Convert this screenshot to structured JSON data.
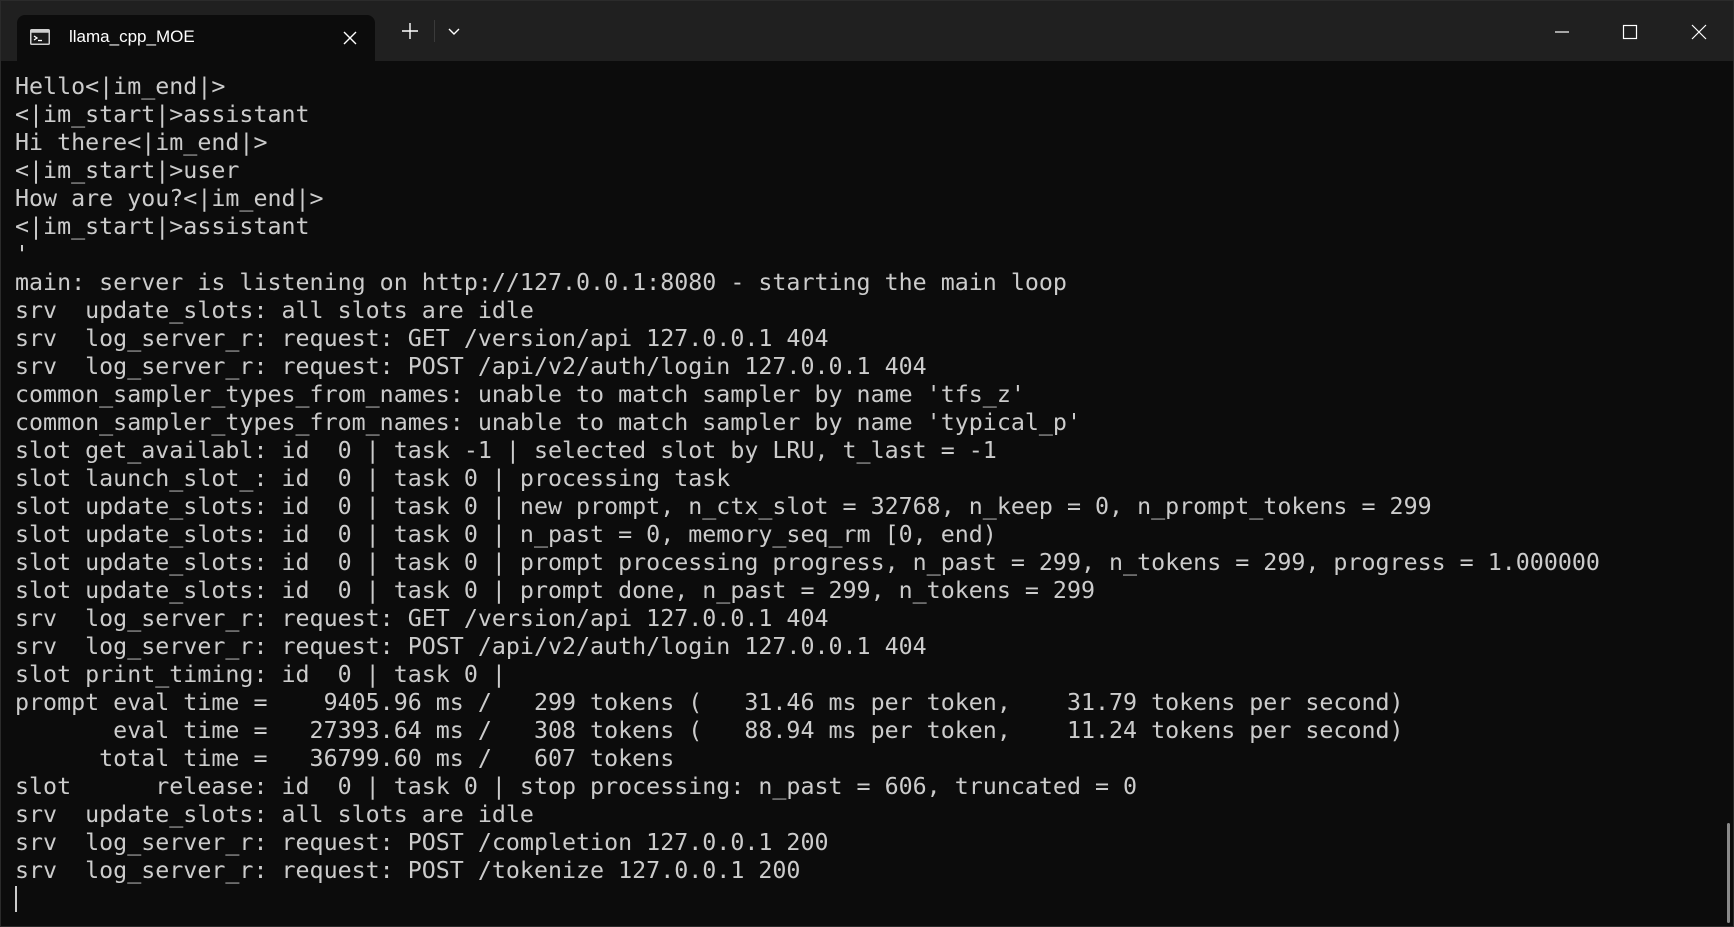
{
  "window": {
    "tab_title": "llama_cpp_MOE",
    "tab_icon": "terminal-icon",
    "titlebar_buttons": [
      "new-tab-icon",
      "chevron-down-icon"
    ],
    "window_controls": [
      "minimize-icon",
      "maximize-icon",
      "close-icon"
    ]
  },
  "terminal": {
    "lines": [
      "Hello<|im_end|>",
      "<|im_start|>assistant",
      "Hi there<|im_end|>",
      "<|im_start|>user",
      "How are you?<|im_end|>",
      "<|im_start|>assistant",
      "'",
      "main: server is listening on http://127.0.0.1:8080 - starting the main loop",
      "srv  update_slots: all slots are idle",
      "srv  log_server_r: request: GET /version/api 127.0.0.1 404",
      "srv  log_server_r: request: POST /api/v2/auth/login 127.0.0.1 404",
      "common_sampler_types_from_names: unable to match sampler by name 'tfs_z'",
      "common_sampler_types_from_names: unable to match sampler by name 'typical_p'",
      "slot get_availabl: id  0 | task -1 | selected slot by LRU, t_last = -1",
      "slot launch_slot_: id  0 | task 0 | processing task",
      "slot update_slots: id  0 | task 0 | new prompt, n_ctx_slot = 32768, n_keep = 0, n_prompt_tokens = 299",
      "slot update_slots: id  0 | task 0 | n_past = 0, memory_seq_rm [0, end)",
      "slot update_slots: id  0 | task 0 | prompt processing progress, n_past = 299, n_tokens = 299, progress = 1.000000",
      "slot update_slots: id  0 | task 0 | prompt done, n_past = 299, n_tokens = 299",
      "srv  log_server_r: request: GET /version/api 127.0.0.1 404",
      "srv  log_server_r: request: POST /api/v2/auth/login 127.0.0.1 404",
      "slot print_timing: id  0 | task 0 |",
      "prompt eval time =    9405.96 ms /   299 tokens (   31.46 ms per token,    31.79 tokens per second)",
      "       eval time =   27393.64 ms /   308 tokens (   88.94 ms per token,    11.24 tokens per second)",
      "      total time =   36799.60 ms /   607 tokens",
      "slot      release: id  0 | task 0 | stop processing: n_past = 606, truncated = 0",
      "srv  update_slots: all slots are idle",
      "srv  log_server_r: request: POST /completion 127.0.0.1 200",
      "srv  log_server_r: request: POST /tokenize 127.0.0.1 200"
    ]
  },
  "colors": {
    "background": "#0c0c0c",
    "titlebar": "#202020",
    "foreground": "#cccccc"
  }
}
